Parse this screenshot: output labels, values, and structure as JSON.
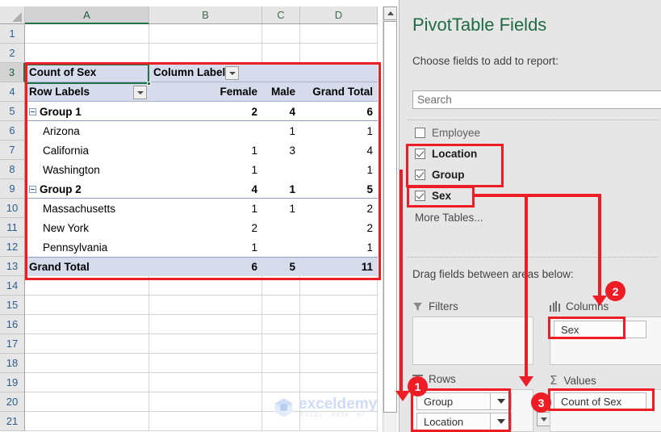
{
  "spreadsheet": {
    "column_headers": [
      "A",
      "B",
      "C",
      "D"
    ],
    "row_headers": [
      "1",
      "2",
      "3",
      "4",
      "5",
      "6",
      "7",
      "8",
      "9",
      "10",
      "11",
      "12",
      "13",
      "14",
      "15",
      "16",
      "17",
      "18",
      "19",
      "20",
      "21"
    ],
    "active_cell": "A3",
    "watermark": {
      "text": "exceldemy",
      "subtext": "EXCEL - DATA - BI"
    }
  },
  "pivot": {
    "value_field_label": "Count of Sex",
    "column_labels_header": "Column Labels",
    "row_labels_header": "Row Labels",
    "column_headers": [
      "Female",
      "Male",
      "Grand Total"
    ],
    "rows": [
      {
        "label": "Group 1",
        "type": "group",
        "values": [
          "2",
          "4",
          "6"
        ]
      },
      {
        "label": "Arizona",
        "type": "item",
        "values": [
          "",
          "1",
          "1"
        ]
      },
      {
        "label": "California",
        "type": "item",
        "values": [
          "1",
          "3",
          "4"
        ]
      },
      {
        "label": "Washington",
        "type": "item",
        "values": [
          "1",
          "",
          "1"
        ]
      },
      {
        "label": "Group 2",
        "type": "group",
        "values": [
          "4",
          "1",
          "5"
        ]
      },
      {
        "label": "Massachusetts",
        "type": "item",
        "values": [
          "1",
          "1",
          "2"
        ]
      },
      {
        "label": "New York",
        "type": "item",
        "values": [
          "2",
          "",
          "2"
        ]
      },
      {
        "label": "Pennsylvania",
        "type": "item",
        "values": [
          "1",
          "",
          "1"
        ]
      }
    ],
    "grand_total": {
      "label": "Grand Total",
      "values": [
        "6",
        "5",
        "11"
      ]
    }
  },
  "pane": {
    "title": "PivotTable Fields",
    "subtitle": "Choose fields to add to report:",
    "search_placeholder": "Search",
    "fields": [
      {
        "label": "Employee",
        "checked": false
      },
      {
        "label": "Location",
        "checked": true
      },
      {
        "label": "Group",
        "checked": true
      },
      {
        "label": "Sex",
        "checked": true
      }
    ],
    "more_tables": "More Tables...",
    "drag_label": "Drag fields between areas below:",
    "areas": {
      "filters": {
        "title": "Filters",
        "icon": "funnel-icon",
        "items": []
      },
      "columns": {
        "title": "Columns",
        "icon": "columns-icon",
        "items": [
          "Sex"
        ]
      },
      "rows": {
        "title": "Rows",
        "icon": "rows-icon",
        "items": [
          "Group",
          "Location"
        ]
      },
      "values": {
        "title": "Values",
        "icon": "sigma-icon",
        "items": [
          "Count of Sex"
        ]
      }
    }
  },
  "annotations": {
    "badges": [
      "1",
      "2",
      "3"
    ],
    "color": "#EE1C25"
  }
}
